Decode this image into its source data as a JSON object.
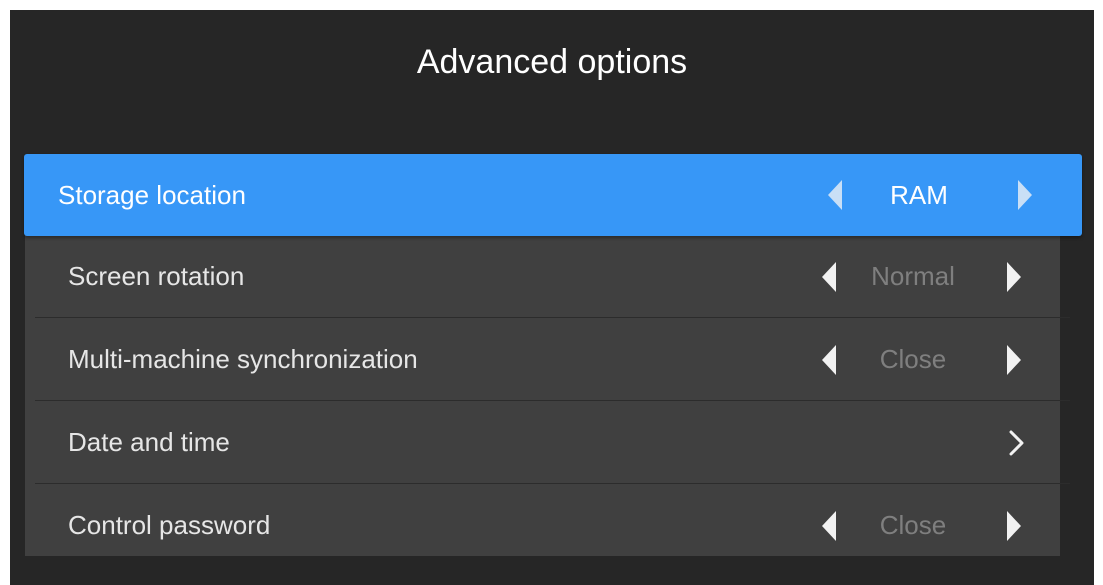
{
  "dialog": {
    "title": "Advanced options"
  },
  "settings": [
    {
      "label": "Storage location",
      "value": "RAM",
      "selected": true
    },
    {
      "label": "Screen rotation",
      "value": "Normal"
    },
    {
      "label": "Multi-machine synchronization",
      "value": "Close"
    },
    {
      "label": "Date and time",
      "value": ""
    },
    {
      "label": "Control password",
      "value": "Close"
    }
  ],
  "colors": {
    "panel_background": "#262626",
    "list_background": "#404040",
    "selected_accent": "#3797f7",
    "value_muted": "#7f7f7f"
  },
  "icons": {
    "previous": "triangle-left-icon",
    "next": "triangle-right-icon",
    "enter": "chevron-right-icon"
  }
}
